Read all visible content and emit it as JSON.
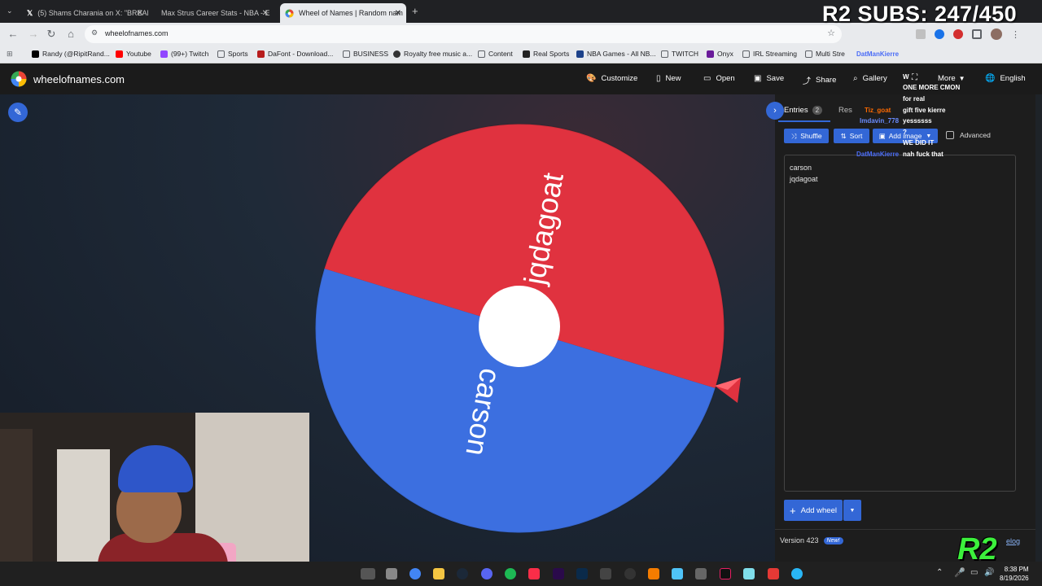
{
  "browser": {
    "tabs": [
      {
        "title": "(5) Shams Charania on X: \"BREAK",
        "icon": "x-logo-icon"
      },
      {
        "title": "Max Strus Career Stats - NBA - E",
        "icon": "espn-icon"
      },
      {
        "title": "Wheel of Names | Random nam",
        "icon": "wheel-icon",
        "active": true
      }
    ],
    "url": "wheelofnames.com",
    "bookmarks": [
      {
        "label": "Randy (@RipitRand...",
        "color": "#000000"
      },
      {
        "label": "Youtube",
        "color": "#ff0000"
      },
      {
        "label": "(99+) Twitch",
        "color": "#9146ff"
      },
      {
        "label": "Sports",
        "color": "#5f6368"
      },
      {
        "label": "DaFont - Download...",
        "color": "#b71c1c"
      },
      {
        "label": "BUSINESS",
        "color": "#5f6368"
      },
      {
        "label": "Royalty free music a...",
        "color": "#333333"
      },
      {
        "label": "Content",
        "color": "#5f6368"
      },
      {
        "label": "Real Sports",
        "color": "#222222"
      },
      {
        "label": "NBA Games - All NB...",
        "color": "#1d428a"
      },
      {
        "label": "TWITCH",
        "color": "#5f6368"
      },
      {
        "label": "Onyx",
        "color": "#6a1b9a"
      },
      {
        "label": "IRL Streaming",
        "color": "#5f6368"
      },
      {
        "label": "Multi Stre",
        "color": "#5f6368"
      }
    ]
  },
  "app": {
    "brand": "wheelofnames.com",
    "menu": {
      "customize": "Customize",
      "new": "New",
      "open": "Open",
      "save": "Save",
      "share": "Share",
      "gallery": "Gallery",
      "more": "More",
      "language": "English"
    },
    "panel": {
      "entries_tab": "Entries",
      "entries_count": "2",
      "results_tab": "Res",
      "shuffle": "Shuffle",
      "sort": "Sort",
      "add_image": "Add image",
      "advanced": "Advanced",
      "add_wheel": "Add wheel",
      "version": "Version 423",
      "new_badge": "New!",
      "changelog": "elog"
    },
    "entries": [
      "carson",
      "jqdagoat"
    ],
    "wheel": {
      "segments": [
        {
          "label": "jqdagoat",
          "color": "#e0323f"
        },
        {
          "label": "carson",
          "color": "#3c6fe0"
        }
      ]
    }
  },
  "overlay": {
    "subs": "R2 SUBS: 247/450",
    "logo": "R2",
    "chat": [
      {
        "user": "DatManKierre",
        "msg": "",
        "color": "#4a6cf7"
      },
      {
        "user": "",
        "msg": "W",
        "color": "#ffffff"
      },
      {
        "user": "",
        "msg": "ONE MORE CMON",
        "color": "#ff4040"
      },
      {
        "user": "",
        "msg": "for real",
        "color": "#8a4cff"
      },
      {
        "user": "Tiz_goat",
        "msg": "gift five kierre",
        "color": "#ff6a00"
      },
      {
        "user": "Imdavin_778",
        "msg": "yessssss",
        "color": "#6a8cff"
      },
      {
        "user": "",
        "msg": "?",
        "color": "#4caf50"
      },
      {
        "user": "",
        "msg": "WE DID IT",
        "color": "#ff2e2e"
      },
      {
        "user": "DatManKierre",
        "msg": "nah fuck that",
        "color": "#4a6cf7"
      }
    ]
  },
  "taskbar": {
    "time": "8:38 PM",
    "date": "8/19/2026"
  }
}
